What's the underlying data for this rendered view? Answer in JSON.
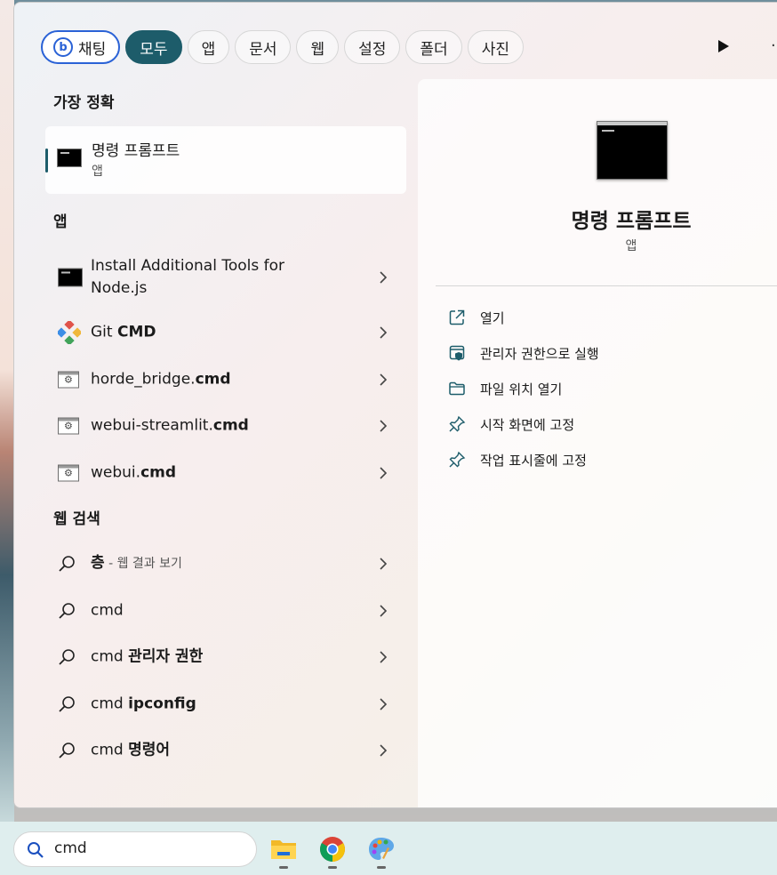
{
  "filters": [
    {
      "label": "채팅",
      "active": false
    },
    {
      "label": "모두",
      "active": true
    },
    {
      "label": "앱",
      "active": false
    },
    {
      "label": "문서",
      "active": false
    },
    {
      "label": "웹",
      "active": false
    },
    {
      "label": "설정",
      "active": false
    },
    {
      "label": "폴더",
      "active": false
    },
    {
      "label": "사진",
      "active": false
    }
  ],
  "best_match": {
    "section_title": "가장 정확",
    "name": "명령 프롬프트",
    "type": "앱"
  },
  "apps": {
    "section_title": "앱",
    "items": [
      {
        "line1": "Install Additional Tools for",
        "line2": "Node.js"
      },
      {
        "pre": "Git ",
        "bold": "CMD"
      },
      {
        "pre": "horde_bridge.",
        "bold": "cmd"
      },
      {
        "pre": "webui-streamlit.",
        "bold": "cmd"
      },
      {
        "pre": "webui.",
        "bold": "cmd"
      }
    ]
  },
  "web": {
    "section_title": "웹 검색",
    "items": [
      {
        "bold": "층",
        "note": " - 웹 결과 보기"
      },
      {
        "pre": "cmd"
      },
      {
        "pre": "cmd ",
        "bold": "관리자 권한"
      },
      {
        "pre": "cmd ",
        "bold": "ipconfig"
      },
      {
        "pre": "cmd ",
        "bold": "명령어"
      }
    ]
  },
  "detail": {
    "title": "명령 프롬프트",
    "subtitle": "앱",
    "actions": [
      {
        "label": "열기",
        "icon": "open-external-icon"
      },
      {
        "label": "관리자 권한으로 실행",
        "icon": "run-as-admin-icon"
      },
      {
        "label": "파일 위치 열기",
        "icon": "folder-icon"
      },
      {
        "label": "시작 화면에 고정",
        "icon": "pin-icon"
      },
      {
        "label": "작업 표시줄에 고정",
        "icon": "pin-icon"
      }
    ]
  },
  "taskbar": {
    "search_value": "cmd",
    "apps": [
      "file-explorer-icon",
      "chrome-icon",
      "paint-icon"
    ]
  },
  "colors": {
    "accent": "#1d5c6a",
    "bing": "#2a62d6"
  }
}
